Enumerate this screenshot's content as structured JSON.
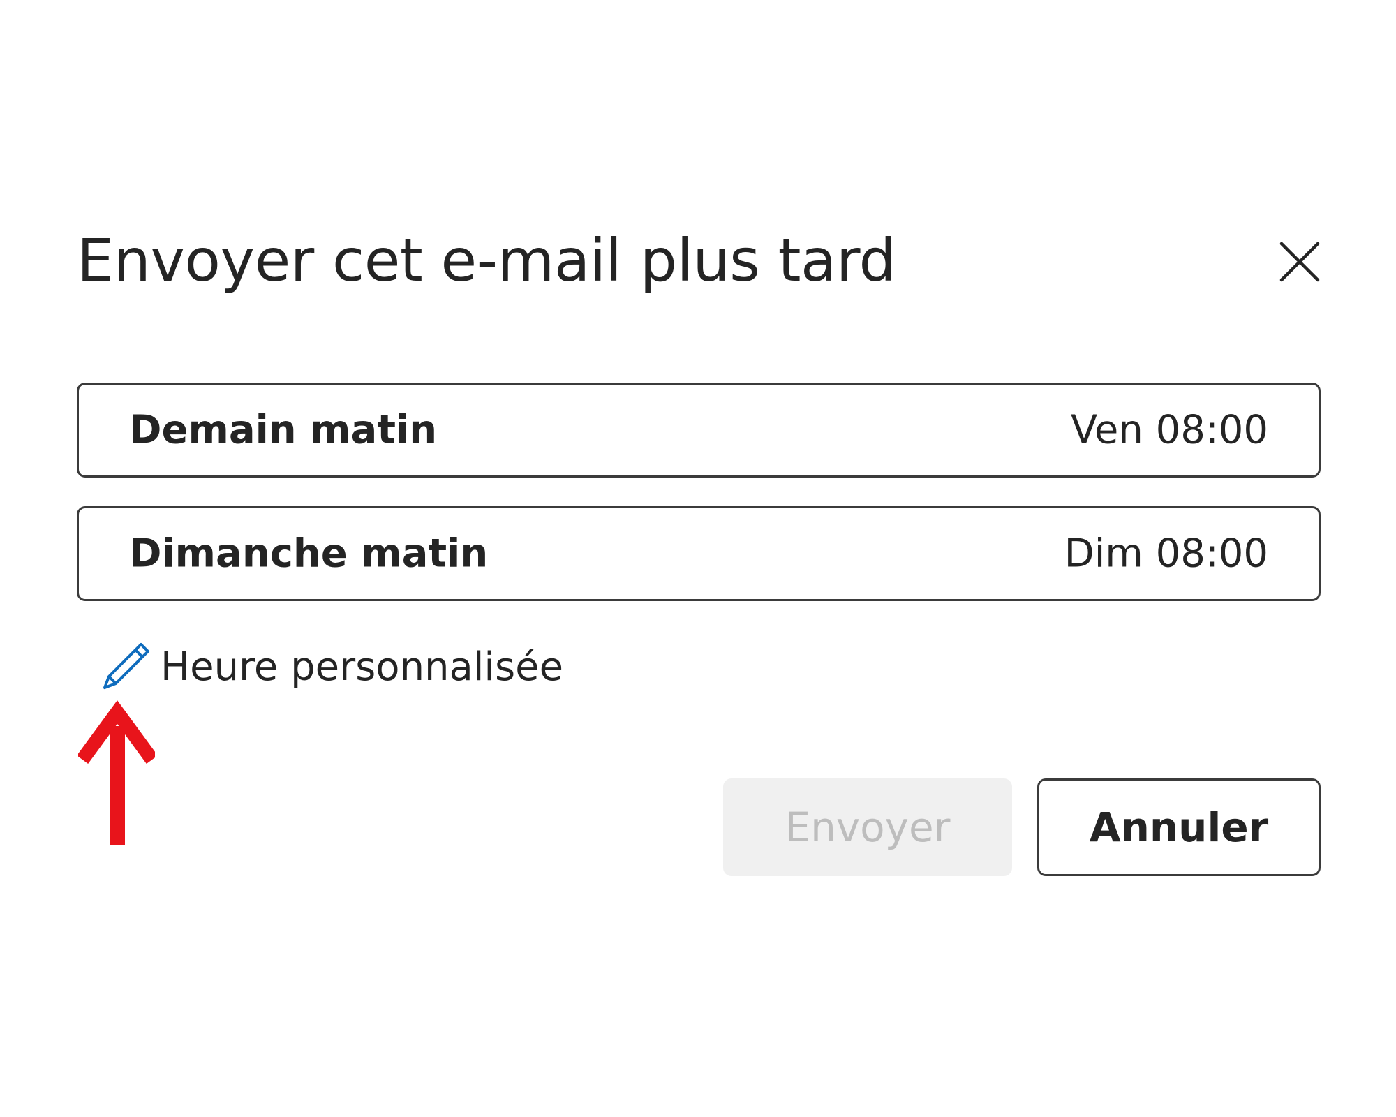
{
  "dialog": {
    "title": "Envoyer cet e-mail plus tard",
    "close_icon": "close-icon"
  },
  "options": [
    {
      "label": "Demain matin",
      "time": "Ven 08:00"
    },
    {
      "label": "Dimanche matin",
      "time": "Dim 08:00"
    }
  ],
  "custom_time": {
    "icon": "pencil-icon",
    "label": "Heure personnalisée"
  },
  "buttons": {
    "send_label": "Envoyer",
    "cancel_label": "Annuler"
  },
  "colors": {
    "accent": "#0f6cbd",
    "annotation": "#e8141b",
    "border": "#3b3b3b",
    "disabled_bg": "#f0f0f0",
    "disabled_text": "#bdbdbd"
  }
}
